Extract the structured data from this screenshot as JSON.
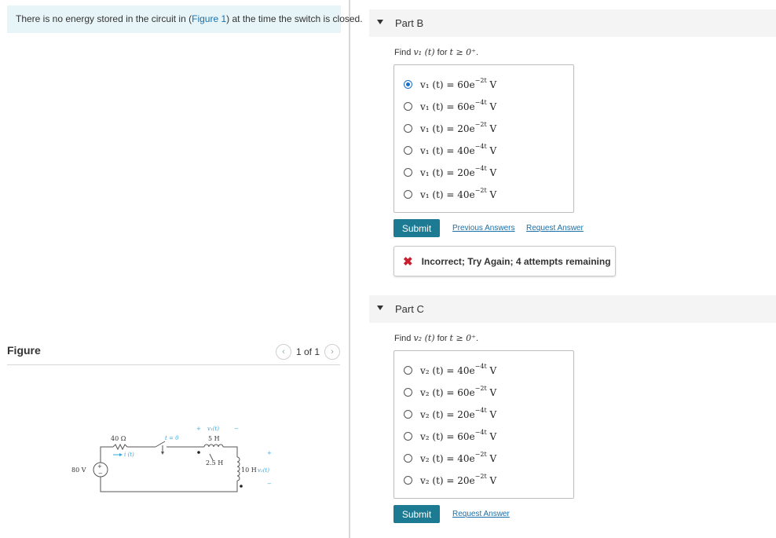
{
  "intro": {
    "before": "There is no energy stored in the circuit in (",
    "link": "Figure 1",
    "after": ") at the time the switch is closed."
  },
  "figure": {
    "title": "Figure",
    "pager": "1 of 1",
    "prev_icon": "chevron-left-icon",
    "next_icon": "chevron-right-icon",
    "circuit": {
      "source": "80 V",
      "source_plus": "+",
      "source_minus": "−",
      "resistor": "40 Ω",
      "current": "i (t)",
      "switch": "t = 0",
      "v1": "v₁(t)",
      "plus": "+",
      "minus": "−",
      "l1": "5 H",
      "mutual": "2.5 H",
      "l2": "10 H",
      "v2": "v₂(t)"
    }
  },
  "partB": {
    "label": "Part B",
    "prompt_text": "Find ",
    "prompt_var": "v₁ (t)",
    "prompt_for": " for ",
    "prompt_cond": "t ≥ 0⁺",
    "prompt_end": ".",
    "selected_index": 0,
    "options": [
      {
        "lhs": "v₁ (t) = 60e",
        "exp": "−2t",
        "unit": " V"
      },
      {
        "lhs": "v₁ (t) = 60e",
        "exp": "−4t",
        "unit": " V"
      },
      {
        "lhs": "v₁ (t) = 20e",
        "exp": "−2t",
        "unit": " V"
      },
      {
        "lhs": "v₁ (t) = 40e",
        "exp": "−4t",
        "unit": " V"
      },
      {
        "lhs": "v₁ (t) = 20e",
        "exp": "−4t",
        "unit": " V"
      },
      {
        "lhs": "v₁ (t) = 40e",
        "exp": "−2t",
        "unit": " V"
      }
    ],
    "submit": "Submit",
    "previous_answers": "Previous Answers",
    "request_answer": "Request Answer",
    "feedback_icon": "x-icon",
    "feedback": "Incorrect; Try Again; 4 attempts remaining",
    "feedback_color": "#c8202f"
  },
  "partC": {
    "label": "Part C",
    "prompt_text": "Find ",
    "prompt_var": "v₂ (t)",
    "prompt_for": " for ",
    "prompt_cond": "t ≥ 0⁺",
    "prompt_end": ".",
    "options": [
      {
        "lhs": "v₂ (t) = 40e",
        "exp": "−4t",
        "unit": " V"
      },
      {
        "lhs": "v₂ (t) = 60e",
        "exp": "−2t",
        "unit": " V"
      },
      {
        "lhs": "v₂ (t) = 20e",
        "exp": "−4t",
        "unit": " V"
      },
      {
        "lhs": "v₂ (t) = 60e",
        "exp": "−4t",
        "unit": " V"
      },
      {
        "lhs": "v₂ (t) = 40e",
        "exp": "−2t",
        "unit": " V"
      },
      {
        "lhs": "v₂ (t) = 20e",
        "exp": "−2t",
        "unit": " V"
      }
    ],
    "submit": "Submit",
    "request_answer": "Request Answer"
  },
  "colors": {
    "accent": "#1c7a93",
    "link": "#1a6fa8",
    "circuit_label": "#3aa6d8"
  }
}
